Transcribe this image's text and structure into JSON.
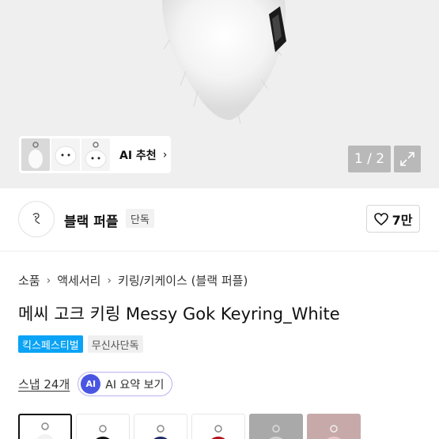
{
  "gallery": {
    "page_current": "1",
    "page_sep": " / ",
    "page_total": "2",
    "ai_recommend_label": "AI 추천",
    "chevron": "›"
  },
  "brand": {
    "name": "블랙 퍼플",
    "badge": "단독",
    "like_count": "7만"
  },
  "breadcrumb": [
    "소품",
    "액세서리",
    "키링/키케이스 (블랙 퍼플)"
  ],
  "product": {
    "title": "메씨 고크 키링 Messy Gok Keyring_White",
    "tags": [
      "킥스페스티벌",
      "무신사단독"
    ]
  },
  "snap": {
    "label": "스냅 24개",
    "ai_badge": "AI",
    "ai_summary_label": "AI 요약 보기"
  },
  "colors": {
    "accent_blue": "#0aa3f5",
    "ai_purple": "#4a56e2",
    "options": [
      "white",
      "black",
      "navy",
      "red",
      "grey",
      "pink-grey"
    ]
  }
}
